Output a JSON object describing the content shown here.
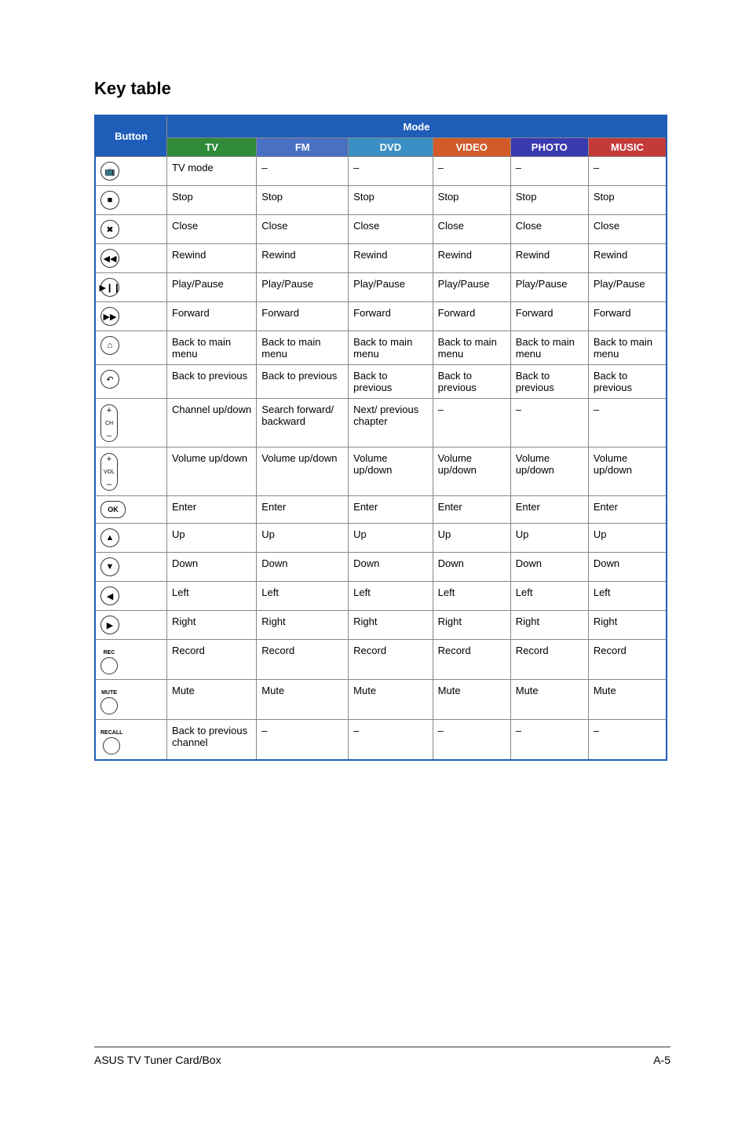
{
  "section_title": "Key table",
  "headers": {
    "button": "Button",
    "mode": "Mode",
    "tv": "TV",
    "fm": "FM",
    "dvd": "DVD",
    "video": "VIDEO",
    "photo": "PHOTO",
    "music": "MUSIC"
  },
  "rows": [
    {
      "btn": "tv-mode-icon",
      "glyph": "tv",
      "tv": "TV mode",
      "fm": "–",
      "dvd": "–",
      "video": "–",
      "photo": "–",
      "music": "–"
    },
    {
      "btn": "stop-icon",
      "glyph": "stop",
      "tv": "Stop",
      "fm": "Stop",
      "dvd": "Stop",
      "video": "Stop",
      "photo": "Stop",
      "music": "Stop"
    },
    {
      "btn": "close-icon",
      "glyph": "close",
      "tv": "Close",
      "fm": "Close",
      "dvd": "Close",
      "video": "Close",
      "photo": "Close",
      "music": "Close"
    },
    {
      "btn": "rewind-icon",
      "glyph": "rewind",
      "tv": "Rewind",
      "fm": "Rewind",
      "dvd": "Rewind",
      "video": "Rewind",
      "photo": "Rewind",
      "music": "Rewind"
    },
    {
      "btn": "play-pause-icon",
      "glyph": "play",
      "tv": "Play/Pause",
      "fm": "Play/Pause",
      "dvd": "Play/Pause",
      "video": "Play/Pause",
      "photo": "Play/Pause",
      "music": "Play/Pause"
    },
    {
      "btn": "forward-icon",
      "glyph": "forward",
      "tv": "Forward",
      "fm": "Forward",
      "dvd": "Forward",
      "video": "Forward",
      "photo": "Forward",
      "music": "Forward"
    },
    {
      "btn": "home-icon",
      "glyph": "home",
      "tv": "Back to main menu",
      "fm": "Back to main menu",
      "dvd": "Back to main menu",
      "video": "Back to main menu",
      "photo": "Back to main menu",
      "music": "Back to main menu"
    },
    {
      "btn": "back-icon",
      "glyph": "back",
      "tv": "Back to previous",
      "fm": "Back to previous",
      "dvd": "Back to previous",
      "video": "Back to previous",
      "photo": "Back to previous",
      "music": "Back to previous"
    },
    {
      "btn": "channel-rocker",
      "glyph": "ch",
      "tv": "Channel up/down",
      "fm": "Search forward/ backward",
      "dvd": "Next/ previous chapter",
      "video": "–",
      "photo": "–",
      "music": "–"
    },
    {
      "btn": "volume-rocker",
      "glyph": "vol",
      "tv": "Volume up/down",
      "fm": "Volume up/down",
      "dvd": "Volume up/down",
      "video": "Volume up/down",
      "photo": "Volume up/down",
      "music": "Volume up/down"
    },
    {
      "btn": "ok-button",
      "glyph": "ok",
      "tv": "Enter",
      "fm": "Enter",
      "dvd": "Enter",
      "video": "Enter",
      "photo": "Enter",
      "music": "Enter"
    },
    {
      "btn": "up-icon",
      "glyph": "up",
      "tv": "Up",
      "fm": "Up",
      "dvd": "Up",
      "video": "Up",
      "photo": "Up",
      "music": "Up"
    },
    {
      "btn": "down-icon",
      "glyph": "down",
      "tv": "Down",
      "fm": "Down",
      "dvd": "Down",
      "video": "Down",
      "photo": "Down",
      "music": "Down"
    },
    {
      "btn": "left-icon",
      "glyph": "left",
      "tv": "Left",
      "fm": "Left",
      "dvd": "Left",
      "video": "Left",
      "photo": "Left",
      "music": "Left"
    },
    {
      "btn": "right-icon",
      "glyph": "right",
      "tv": "Right",
      "fm": "Right",
      "dvd": "Right",
      "video": "Right",
      "photo": "Right",
      "music": "Right"
    },
    {
      "btn": "record-button",
      "glyph": "rec",
      "tv": "Record",
      "fm": "Record",
      "dvd": "Record",
      "video": "Record",
      "photo": "Record",
      "music": "Record"
    },
    {
      "btn": "mute-button",
      "glyph": "mute",
      "tv": "Mute",
      "fm": "Mute",
      "dvd": "Mute",
      "video": "Mute",
      "photo": "Mute",
      "music": "Mute"
    },
    {
      "btn": "recall-button",
      "glyph": "recall",
      "tv": "Back to previous channel",
      "fm": "–",
      "dvd": "–",
      "video": "–",
      "photo": "–",
      "music": "–"
    }
  ],
  "footer": {
    "left": "ASUS TV Tuner Card/Box",
    "right": "A-5"
  },
  "labels": {
    "rec": "REC",
    "mute": "MUTE",
    "recall": "RECALL",
    "ok": "OK",
    "ch": "CH",
    "vol": "VOL"
  }
}
